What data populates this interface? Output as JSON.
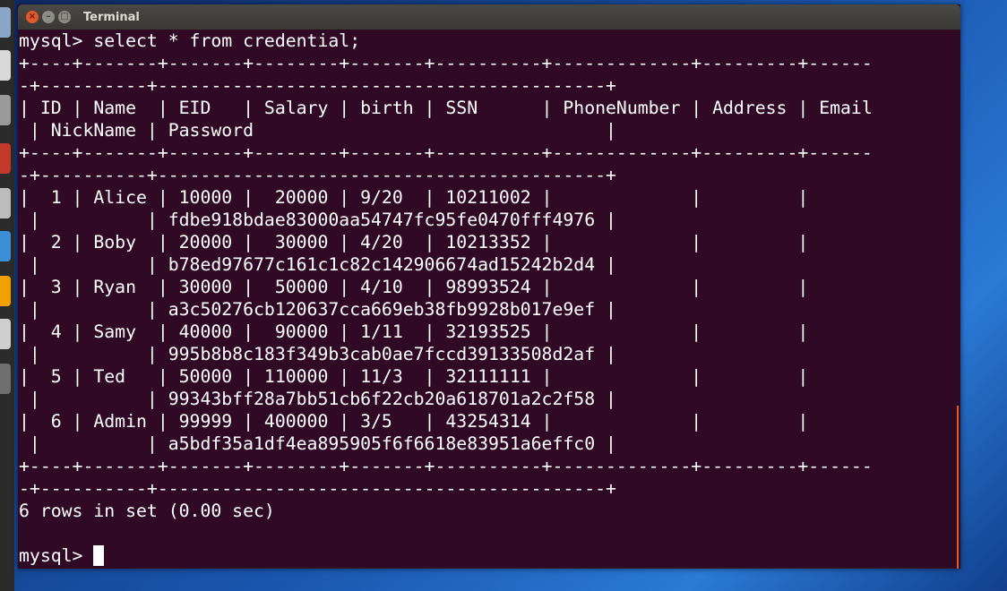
{
  "window": {
    "title": "Terminal"
  },
  "colors": {
    "terminal_background": "#300a24",
    "terminal_text": "#ffffff",
    "titlebar": "#3c3b37",
    "close_button": "#e1582c"
  },
  "terminal": {
    "lines": [
      "mysql> select * from credential;",
      "+----+-------+-------+--------+-------+----------+-------------+---------+------",
      "-+----------+------------------------------------------+",
      "| ID | Name  | EID   | Salary | birth | SSN      | PhoneNumber | Address | Email",
      " | NickName | Password                                 |",
      "+----+-------+-------+--------+-------+----------+-------------+---------+------",
      "-+----------+------------------------------------------+",
      "|  1 | Alice | 10000 |  20000 | 9/20  | 10211002 |             |         |",
      " |          | fdbe918bdae83000aa54747fc95fe0470fff4976 |",
      "|  2 | Boby  | 20000 |  30000 | 4/20  | 10213352 |             |         |",
      " |          | b78ed97677c161c1c82c142906674ad15242b2d4 |",
      "|  3 | Ryan  | 30000 |  50000 | 4/10  | 98993524 |             |         |",
      " |          | a3c50276cb120637cca669eb38fb9928b017e9ef |",
      "|  4 | Samy  | 40000 |  90000 | 1/11  | 32193525 |             |         |",
      " |          | 995b8b8c183f349b3cab0ae7fccd39133508d2af |",
      "|  5 | Ted   | 50000 | 110000 | 11/3  | 32111111 |             |         |",
      " |          | 99343bff28a7bb51cb6f22cb20a618701a2c2f58 |",
      "|  6 | Admin | 99999 | 400000 | 3/5   | 43254314 |             |         |",
      " |          | a5bdf35a1df4ea895905f6f6618e83951a6effc0 |",
      "+----+-------+-------+--------+-------+----------+-------------+---------+------",
      "-+----------+------------------------------------------+",
      "6 rows in set (0.00 sec)",
      ""
    ],
    "prompt": "mysql> "
  }
}
